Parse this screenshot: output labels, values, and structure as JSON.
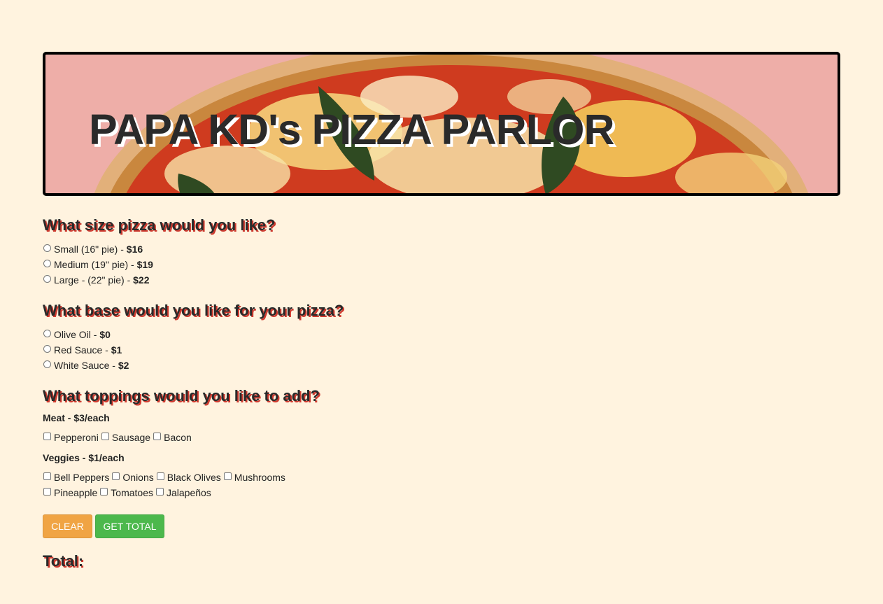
{
  "header": {
    "title": "PAPA KD's PIZZA PARLOR"
  },
  "size_section": {
    "heading": "What size pizza would you like?",
    "options": [
      {
        "label": "Small (16\" pie) - ",
        "price": "$16"
      },
      {
        "label": "Medium (19\" pie) - ",
        "price": "$19"
      },
      {
        "label": "Large - (22\" pie) - ",
        "price": "$22"
      }
    ]
  },
  "base_section": {
    "heading": "What base would you like for your pizza?",
    "options": [
      {
        "label": "Olive Oil - ",
        "price": "$0"
      },
      {
        "label": "Red Sauce - ",
        "price": "$1"
      },
      {
        "label": "White Sauce - ",
        "price": "$2"
      }
    ]
  },
  "toppings_section": {
    "heading": "What toppings would you like to add?",
    "meat_heading": "Meat - $3/each",
    "meats": [
      "Pepperoni",
      "Sausage",
      "Bacon"
    ],
    "veggies_heading": "Veggies - $1/each",
    "veggies": [
      "Bell Peppers",
      "Onions",
      "Black Olives",
      "Mushrooms",
      "Pineapple",
      "Tomatoes",
      "Jalapeños"
    ]
  },
  "buttons": {
    "clear": "CLEAR",
    "get_total": "GET TOTAL"
  },
  "total": {
    "label": "Total:"
  },
  "colors": {
    "page_background": "#fff3df",
    "banner_background": "#eeaea8",
    "clear_button": "#f0a444",
    "total_button": "#4cb84c",
    "heading_shadow": "#cf3a2f"
  }
}
